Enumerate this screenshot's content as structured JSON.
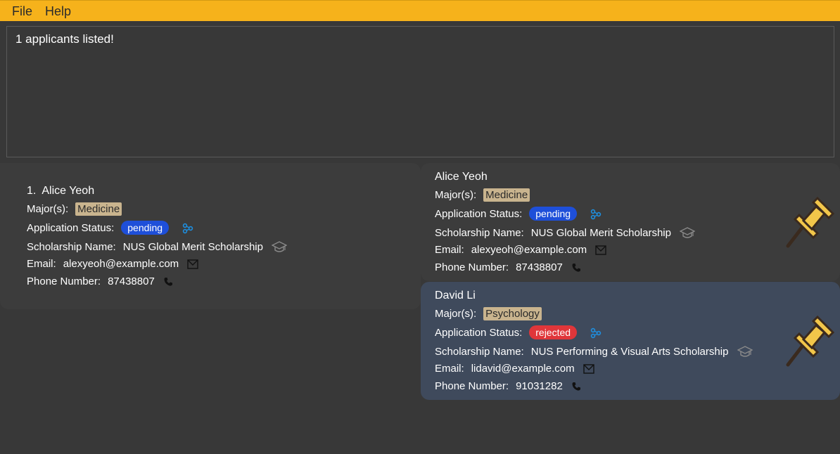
{
  "menu": {
    "file": "File",
    "help": "Help"
  },
  "result_message": "1 applicants listed!",
  "list": {
    "index": "1.",
    "name": "Alice Yeoh",
    "major_label": "Major(s):",
    "major": "Medicine",
    "status_label": "Application Status:",
    "status": "pending",
    "status_color": "#1E4FD9",
    "scholarship_label": "Scholarship Name:",
    "scholarship": "NUS Global Merit Scholarship",
    "email_label": "Email:",
    "email": "alexyeoh@example.com",
    "phone_label": "Phone Number:",
    "phone": "87438807"
  },
  "pinned": [
    {
      "name": "Alice Yeoh",
      "major_label": "Major(s):",
      "major": "Medicine",
      "status_label": "Application Status:",
      "status": "pending",
      "status_color": "#1E4FD9",
      "scholarship_label": "Scholarship Name:",
      "scholarship": "NUS Global Merit Scholarship",
      "email_label": "Email:",
      "email": "alexyeoh@example.com",
      "phone_label": "Phone Number:",
      "phone": "87438807"
    },
    {
      "name": "David Li",
      "major_label": "Major(s):",
      "major": "Psychology",
      "status_label": "Application Status:",
      "status": "rejected",
      "status_color": "#E0363A",
      "scholarship_label": "Scholarship Name:",
      "scholarship": "NUS Performing & Visual Arts Scholarship",
      "email_label": "Email:",
      "email": "lidavid@example.com",
      "phone_label": "Phone Number:",
      "phone": "91031282"
    }
  ],
  "colors": {
    "menubar": "#F6B21B",
    "tag": "#C9B48E",
    "selected_card": "#3f4a5c"
  },
  "icons": [
    "status-network-icon",
    "graduation-cap-icon",
    "envelope-icon",
    "phone-icon",
    "pushpin-icon"
  ]
}
